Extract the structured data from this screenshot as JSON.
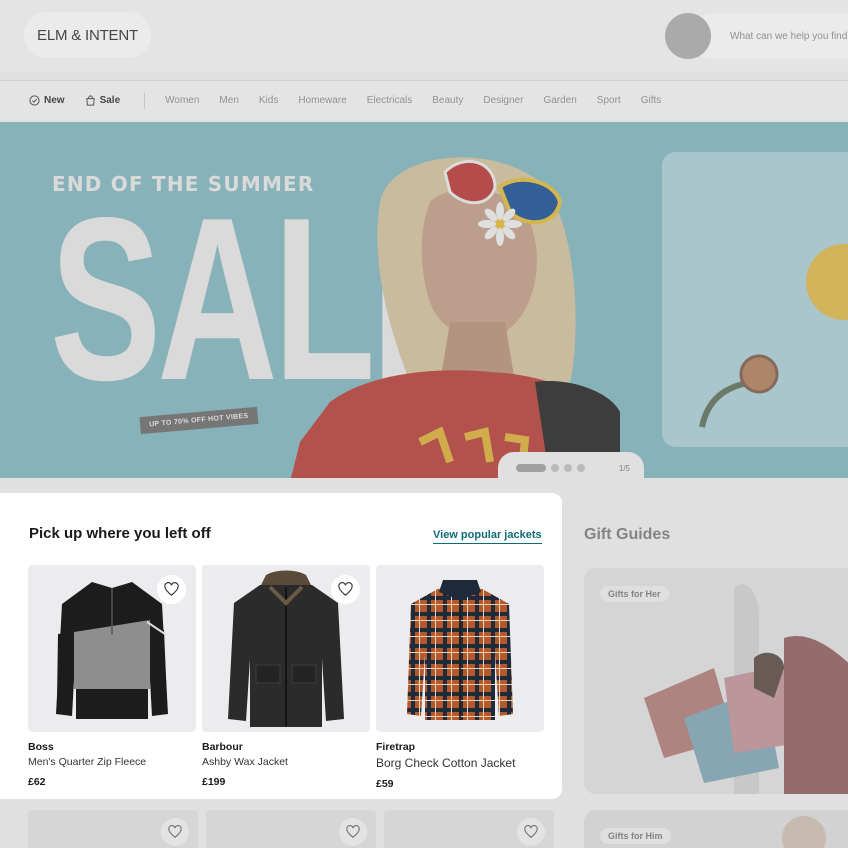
{
  "header": {
    "logo_text": "ELM & INTENT",
    "search_placeholder": "What can we help you find"
  },
  "nav": {
    "primary": [
      {
        "label": "New",
        "icon": "check-circle-icon"
      },
      {
        "label": "Sale",
        "icon": "bag-icon"
      }
    ],
    "categories": [
      "Women",
      "Men",
      "Kids",
      "Homeware",
      "Electricals",
      "Beauty",
      "Designer",
      "Garden",
      "Sport",
      "Gifts"
    ]
  },
  "hero": {
    "tagline": "END OF THE SUMMER",
    "headline": "SALE",
    "badge": "UP TO 70% OFF HOT VIBES",
    "pager": {
      "current": 1,
      "total": 5,
      "label": "1/5"
    }
  },
  "recent": {
    "title": "Pick up where you left off",
    "link": "View popular jackets",
    "products": [
      {
        "brand": "Boss",
        "name": "Men's Quarter Zip Fleece",
        "price": "£62",
        "favourite_icon": "heart-icon"
      },
      {
        "brand": "Barbour",
        "name": "Ashby Wax Jacket",
        "price": "£199",
        "favourite_icon": "heart-icon"
      },
      {
        "brand": "Firetrap",
        "name": "Borg Check Cotton Jacket",
        "price": "£59",
        "favourite_icon": "heart-icon"
      }
    ]
  },
  "gift_guides": {
    "title": "Gift Guides",
    "cards": [
      {
        "label": "Gifts for Her"
      },
      {
        "label": "Gifts for Him"
      }
    ]
  },
  "colors": {
    "accent_link": "#0f6b73",
    "hero_background": "#8fbfc6",
    "overlay": "rgba(90,90,90,0.12)"
  }
}
